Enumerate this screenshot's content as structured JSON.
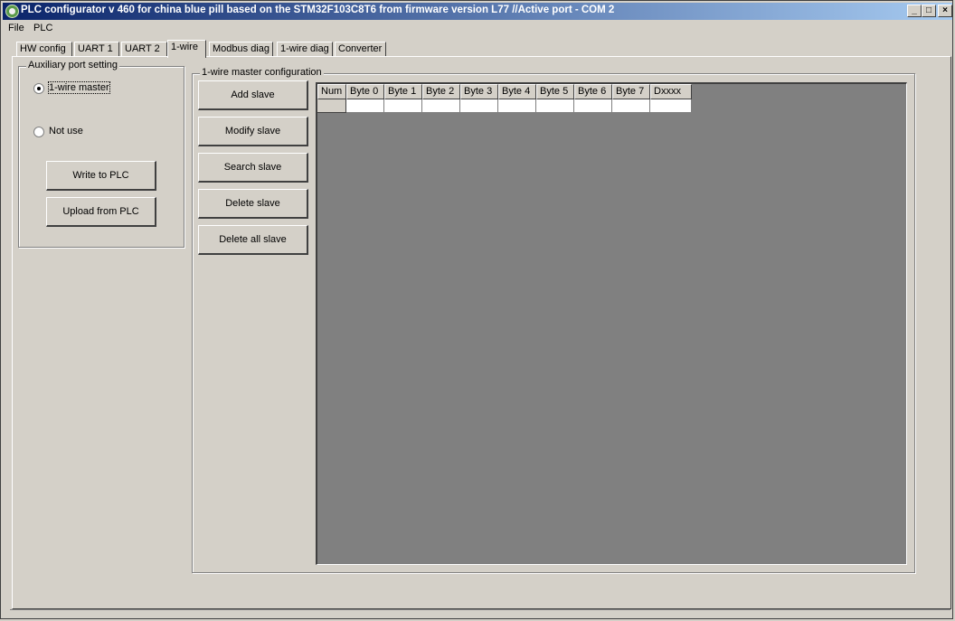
{
  "window": {
    "title": "PLC configurator v 460 for china blue pill based on the STM32F103C8T6 from firmware version L77     //Active port - COM 2",
    "controls": [
      "_",
      "□",
      "×"
    ]
  },
  "menu": [
    {
      "label": "File"
    },
    {
      "label": "PLC"
    }
  ],
  "tabs": [
    {
      "label": "HW config"
    },
    {
      "label": "UART 1"
    },
    {
      "label": "UART 2"
    },
    {
      "label": "1-wire",
      "active": true
    },
    {
      "label": "Modbus diag"
    },
    {
      "label": "1-wire diag"
    },
    {
      "label": "Converter"
    }
  ],
  "aux": {
    "title": "Auxiliary port setting",
    "radio_master": "1-wire master",
    "radio_notuse": "Not use",
    "write_btn": "Write to PLC",
    "upload_btn": "Upload from PLC"
  },
  "master": {
    "title": "1-wire master configuration",
    "buttons": [
      "Add slave",
      "Modify slave",
      "Search slave",
      "Delete slave",
      "Delete all slave"
    ]
  },
  "grid": {
    "columns": [
      "Num",
      "Byte 0",
      "Byte 1",
      "Byte 2",
      "Byte 3",
      "Byte 4",
      "Byte 5",
      "Byte 6",
      "Byte 7",
      "Dxxxx"
    ]
  }
}
